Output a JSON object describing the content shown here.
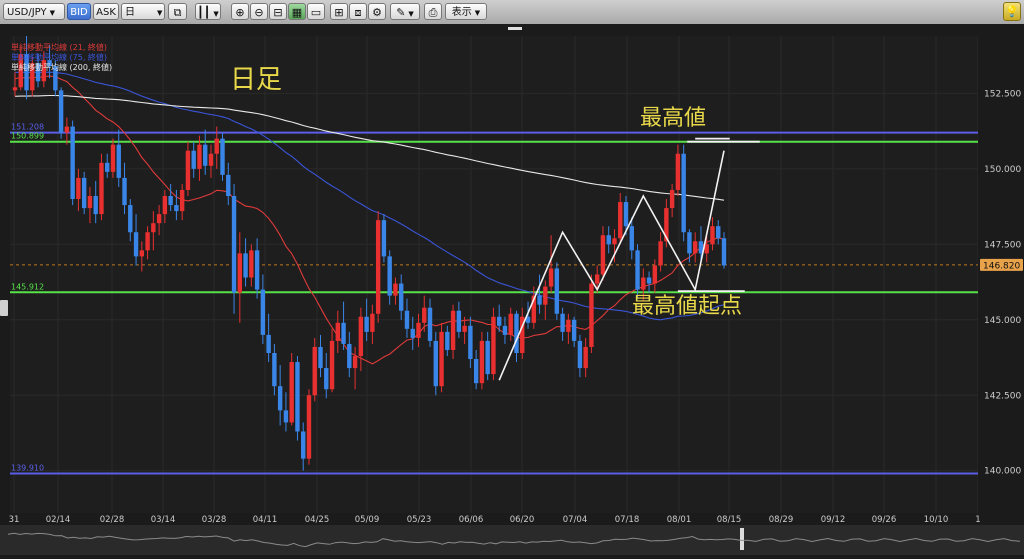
{
  "toolbar": {
    "symbol": "USD/JPY",
    "bid": "BID",
    "ask": "ASK",
    "timeframe": "日",
    "display": "表示"
  },
  "chart_data": {
    "type": "candlestick",
    "timeframe_label": "日足",
    "ylim": [
      138.6,
      154.4
    ],
    "yticks": [
      140.0,
      142.5,
      145.0,
      147.5,
      150.0,
      152.5
    ],
    "ytick_labels": [
      "140.000",
      "142.500",
      "145.000",
      "147.500",
      "150.000",
      "152.500"
    ],
    "xtick_labels": [
      "31",
      "02/14",
      "02/28",
      "03/14",
      "03/28",
      "04/11",
      "04/25",
      "05/09",
      "05/23",
      "06/06",
      "06/20",
      "07/04",
      "07/18",
      "08/01",
      "08/15",
      "08/29",
      "09/12",
      "09/26",
      "10/10",
      "1"
    ],
    "current_price": 146.82,
    "current_price_label": "146.820",
    "legend": [
      {
        "name": "単純移動平均線 (21, 終値)",
        "color": "#e03a3a"
      },
      {
        "name": "単純移動平均線 (75, 終値)",
        "color": "#3a55d8"
      },
      {
        "name": "単純移動平均線 (200, 終値)",
        "color": "#e8e8e8"
      }
    ],
    "hlines": [
      {
        "value": 151.2,
        "label": "151.208",
        "color": "#5a5ee8"
      },
      {
        "value": 150.899,
        "label": "150.899",
        "color": "#58e24a"
      },
      {
        "value": 145.912,
        "label": "145.912",
        "color": "#58e24a"
      },
      {
        "value": 139.91,
        "label": "139.910",
        "color": "#5a5ee8"
      }
    ],
    "annotations": [
      {
        "text": "最高値",
        "color": "#e8d84a"
      },
      {
        "text": "最高値起点",
        "color": "#e8d84a"
      }
    ],
    "candles": [
      [
        152.6,
        153.2,
        152.4,
        152.7
      ],
      [
        152.7,
        154.0,
        152.6,
        153.8
      ],
      [
        153.8,
        154.4,
        152.3,
        152.6
      ],
      [
        152.6,
        153.7,
        152.4,
        153.5
      ],
      [
        153.5,
        153.8,
        152.7,
        152.9
      ],
      [
        152.9,
        153.9,
        152.7,
        153.6
      ],
      [
        153.6,
        154.1,
        153.0,
        153.4
      ],
      [
        153.4,
        153.6,
        152.4,
        152.6
      ],
      [
        152.6,
        152.7,
        151.0,
        151.2
      ],
      [
        151.2,
        151.7,
        150.8,
        151.4
      ],
      [
        151.4,
        151.6,
        148.8,
        149.0
      ],
      [
        149.0,
        150.0,
        148.6,
        149.7
      ],
      [
        149.7,
        149.9,
        148.5,
        148.7
      ],
      [
        148.7,
        149.4,
        148.2,
        149.1
      ],
      [
        149.1,
        149.6,
        148.2,
        148.5
      ],
      [
        148.5,
        150.5,
        148.3,
        150.2
      ],
      [
        150.2,
        150.5,
        149.7,
        149.9
      ],
      [
        149.9,
        151.0,
        149.7,
        150.8
      ],
      [
        150.8,
        151.3,
        149.4,
        149.7
      ],
      [
        149.7,
        150.2,
        148.5,
        148.8
      ],
      [
        148.8,
        149.0,
        147.6,
        147.9
      ],
      [
        147.9,
        148.5,
        146.8,
        147.1
      ],
      [
        147.1,
        147.6,
        146.6,
        147.3
      ],
      [
        147.3,
        148.1,
        147.0,
        147.9
      ],
      [
        147.9,
        148.6,
        147.3,
        148.2
      ],
      [
        148.2,
        148.8,
        147.8,
        148.5
      ],
      [
        148.5,
        149.3,
        148.2,
        149.1
      ],
      [
        149.1,
        149.5,
        148.6,
        148.8
      ],
      [
        148.8,
        149.3,
        148.3,
        148.6
      ],
      [
        148.6,
        149.5,
        148.3,
        149.3
      ],
      [
        149.3,
        150.9,
        149.1,
        150.6
      ],
      [
        150.6,
        150.9,
        149.7,
        150.0
      ],
      [
        150.0,
        151.1,
        149.6,
        150.8
      ],
      [
        150.8,
        151.3,
        149.8,
        150.1
      ],
      [
        150.1,
        150.8,
        149.7,
        150.5
      ],
      [
        150.5,
        151.4,
        150.0,
        151.0
      ],
      [
        151.0,
        151.2,
        149.6,
        149.8
      ],
      [
        149.8,
        150.2,
        148.8,
        149.1
      ],
      [
        149.1,
        149.5,
        145.2,
        145.9
      ],
      [
        145.9,
        147.9,
        144.9,
        147.2
      ],
      [
        147.2,
        147.7,
        146.1,
        146.4
      ],
      [
        146.4,
        147.5,
        146.1,
        147.3
      ],
      [
        147.3,
        147.7,
        145.7,
        146.0
      ],
      [
        146.0,
        146.5,
        144.2,
        144.5
      ],
      [
        144.5,
        145.2,
        143.6,
        143.9
      ],
      [
        143.9,
        144.2,
        142.5,
        142.8
      ],
      [
        142.8,
        143.5,
        141.5,
        142.0
      ],
      [
        142.0,
        142.6,
        141.3,
        141.6
      ],
      [
        141.6,
        143.9,
        141.5,
        143.6
      ],
      [
        143.6,
        143.8,
        141.0,
        141.3
      ],
      [
        141.3,
        141.6,
        140.0,
        140.4
      ],
      [
        140.4,
        142.7,
        140.2,
        142.5
      ],
      [
        142.5,
        144.4,
        142.3,
        144.1
      ],
      [
        144.1,
        144.5,
        143.1,
        143.4
      ],
      [
        143.4,
        143.9,
        142.4,
        142.7
      ],
      [
        142.7,
        144.7,
        142.6,
        144.3
      ],
      [
        144.3,
        145.3,
        143.9,
        144.9
      ],
      [
        144.9,
        145.6,
        144.0,
        144.2
      ],
      [
        144.2,
        144.6,
        143.1,
        143.4
      ],
      [
        143.4,
        144.1,
        142.7,
        143.8
      ],
      [
        143.8,
        145.4,
        143.3,
        145.1
      ],
      [
        145.1,
        145.7,
        144.3,
        144.6
      ],
      [
        144.6,
        145.5,
        144.2,
        145.2
      ],
      [
        145.2,
        148.6,
        144.9,
        148.3
      ],
      [
        148.3,
        148.5,
        146.9,
        147.1
      ],
      [
        147.1,
        147.3,
        145.5,
        145.8
      ],
      [
        145.8,
        146.4,
        145.5,
        146.2
      ],
      [
        146.2,
        146.5,
        145.0,
        145.3
      ],
      [
        145.3,
        145.7,
        144.4,
        144.7
      ],
      [
        144.7,
        145.1,
        144.0,
        144.4
      ],
      [
        144.4,
        145.2,
        144.1,
        144.9
      ],
      [
        144.9,
        145.8,
        144.6,
        145.4
      ],
      [
        145.4,
        145.7,
        144.1,
        144.3
      ],
      [
        144.3,
        144.6,
        142.5,
        142.8
      ],
      [
        142.8,
        144.9,
        142.6,
        144.6
      ],
      [
        144.6,
        144.8,
        143.8,
        144.0
      ],
      [
        144.0,
        145.5,
        143.7,
        145.3
      ],
      [
        145.3,
        145.6,
        144.4,
        144.6
      ],
      [
        144.6,
        145.1,
        144.2,
        144.8
      ],
      [
        144.8,
        145.1,
        143.4,
        143.7
      ],
      [
        143.7,
        144.0,
        142.7,
        142.9
      ],
      [
        142.9,
        144.6,
        142.7,
        144.3
      ],
      [
        144.3,
        144.6,
        143.0,
        143.2
      ],
      [
        143.2,
        145.4,
        143.0,
        145.1
      ],
      [
        145.1,
        145.5,
        144.6,
        144.8
      ],
      [
        144.8,
        145.1,
        144.2,
        144.5
      ],
      [
        144.5,
        145.4,
        144.3,
        145.2
      ],
      [
        145.2,
        145.3,
        143.6,
        143.9
      ],
      [
        143.9,
        145.4,
        143.7,
        145.1
      ],
      [
        145.1,
        145.6,
        144.7,
        144.9
      ],
      [
        144.9,
        146.1,
        144.7,
        145.8
      ],
      [
        145.8,
        146.5,
        145.2,
        145.5
      ],
      [
        145.5,
        146.3,
        145.0,
        146.1
      ],
      [
        146.1,
        147.8,
        145.9,
        146.7
      ],
      [
        146.7,
        146.9,
        145.0,
        145.2
      ],
      [
        145.2,
        145.4,
        144.3,
        144.6
      ],
      [
        144.6,
        145.2,
        144.2,
        145.0
      ],
      [
        145.0,
        145.1,
        144.1,
        144.3
      ],
      [
        144.3,
        144.5,
        143.1,
        143.4
      ],
      [
        143.4,
        144.4,
        143.1,
        144.1
      ],
      [
        144.1,
        146.5,
        143.9,
        146.2
      ],
      [
        146.2,
        146.8,
        145.9,
        146.5
      ],
      [
        146.5,
        148.1,
        146.3,
        147.8
      ],
      [
        147.8,
        148.1,
        147.2,
        147.5
      ],
      [
        147.5,
        148.0,
        146.9,
        147.7
      ],
      [
        147.7,
        149.2,
        147.5,
        148.9
      ],
      [
        148.9,
        149.1,
        147.8,
        148.1
      ],
      [
        148.1,
        148.4,
        147.0,
        147.3
      ],
      [
        147.3,
        147.5,
        145.7,
        146.0
      ],
      [
        146.0,
        146.7,
        145.6,
        146.4
      ],
      [
        146.4,
        146.6,
        145.9,
        146.2
      ],
      [
        146.2,
        147.0,
        145.9,
        146.8
      ],
      [
        146.8,
        147.9,
        146.6,
        147.6
      ],
      [
        147.6,
        149.0,
        147.4,
        148.7
      ],
      [
        148.7,
        149.5,
        148.4,
        149.3
      ],
      [
        149.3,
        150.8,
        149.1,
        150.5
      ],
      [
        150.5,
        150.8,
        147.6,
        147.9
      ],
      [
        147.9,
        148.0,
        146.9,
        147.2
      ],
      [
        147.2,
        147.9,
        146.9,
        147.6
      ],
      [
        147.6,
        148.1,
        146.9,
        147.2
      ],
      [
        147.2,
        147.8,
        146.9,
        147.5
      ],
      [
        147.5,
        148.4,
        147.3,
        148.1
      ],
      [
        148.1,
        148.3,
        147.5,
        147.7
      ],
      [
        147.7,
        147.9,
        146.7,
        146.8
      ]
    ]
  }
}
